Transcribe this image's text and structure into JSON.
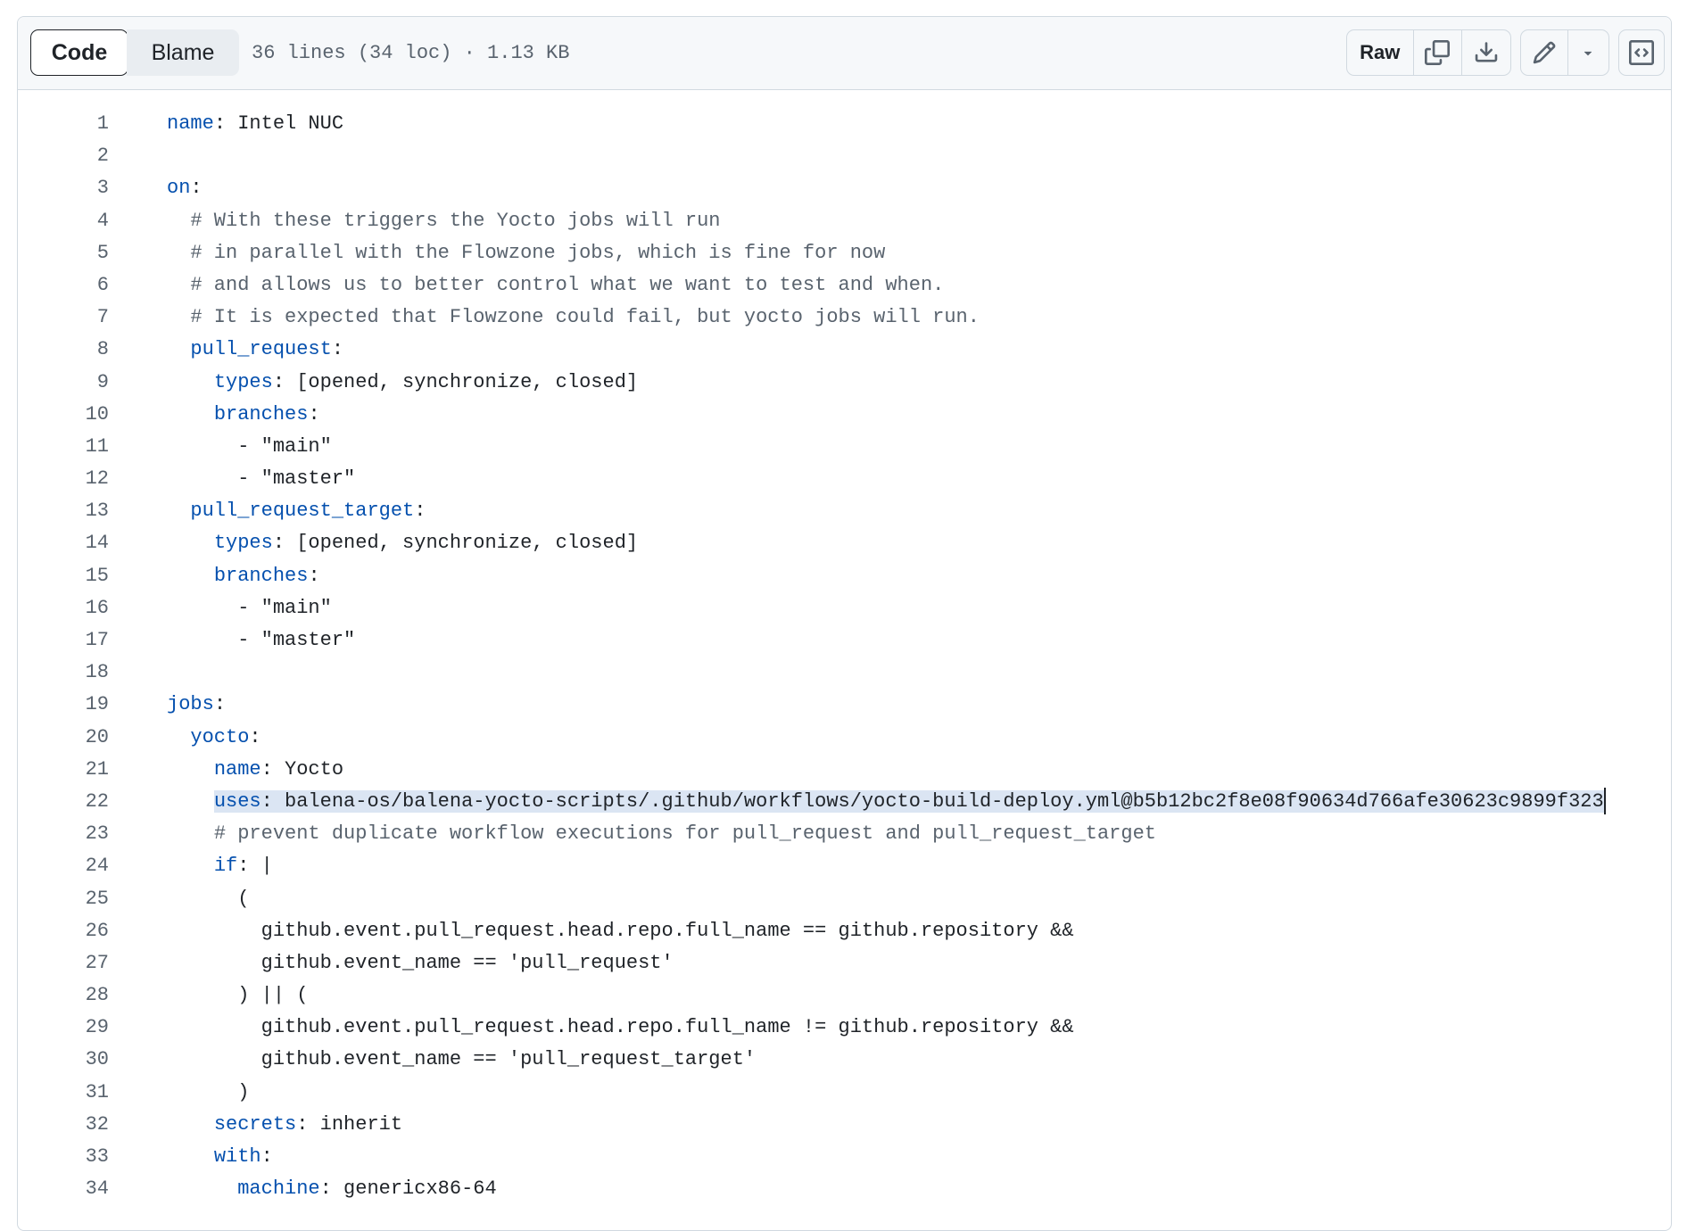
{
  "header": {
    "tab_code": "Code",
    "tab_blame": "Blame",
    "file_info": "36 lines (34 loc) · 1.13 KB",
    "raw_label": "Raw",
    "icons": [
      "copy-icon",
      "download-icon",
      "pencil-icon",
      "chevron-down-icon",
      "code-square-icon"
    ]
  },
  "colors": {
    "key": "#0550ae",
    "value": "#1f2328",
    "string": "#0a3069",
    "comment": "#59636e",
    "selection": "#dbe5f3"
  },
  "code": {
    "lines": [
      {
        "n": "1",
        "indent": "",
        "key": "name",
        "rest": "Intel NUC"
      },
      {
        "n": "2",
        "indent": "",
        "key": "",
        "rest": ""
      },
      {
        "n": "3",
        "indent": "",
        "key": "on",
        "rest": ""
      },
      {
        "n": "4",
        "indent": "  ",
        "comment": "# With these triggers the Yocto jobs will run"
      },
      {
        "n": "5",
        "indent": "  ",
        "comment": "# in parallel with the Flowzone jobs, which is fine for now"
      },
      {
        "n": "6",
        "indent": "  ",
        "comment": "# and allows us to better control what we want to test and when."
      },
      {
        "n": "7",
        "indent": "  ",
        "comment": "# It is expected that Flowzone could fail, but yocto jobs will run."
      },
      {
        "n": "8",
        "indent": "  ",
        "key": "pull_request",
        "rest": ""
      },
      {
        "n": "9",
        "indent": "    ",
        "key": "types",
        "rest": "[opened, synchronize, closed]"
      },
      {
        "n": "10",
        "indent": "    ",
        "key": "branches",
        "rest": ""
      },
      {
        "n": "11",
        "indent": "      ",
        "plain": "- \"main\""
      },
      {
        "n": "12",
        "indent": "      ",
        "plain": "- \"master\""
      },
      {
        "n": "13",
        "indent": "  ",
        "key": "pull_request_target",
        "rest": ""
      },
      {
        "n": "14",
        "indent": "    ",
        "key": "types",
        "rest": "[opened, synchronize, closed]"
      },
      {
        "n": "15",
        "indent": "    ",
        "key": "branches",
        "rest": ""
      },
      {
        "n": "16",
        "indent": "      ",
        "plain": "- \"main\""
      },
      {
        "n": "17",
        "indent": "      ",
        "plain": "- \"master\""
      },
      {
        "n": "18",
        "indent": "",
        "key": "",
        "rest": ""
      },
      {
        "n": "19",
        "indent": "",
        "key": "jobs",
        "rest": ""
      },
      {
        "n": "20",
        "indent": "  ",
        "key": "yocto",
        "rest": ""
      },
      {
        "n": "21",
        "indent": "    ",
        "key": "name",
        "rest": "Yocto"
      },
      {
        "n": "22",
        "indent": "    ",
        "key": "uses",
        "rest": "balena-os/balena-yocto-scripts/.github/workflows/yocto-build-deploy.yml@b5b12bc2f8e08f90634d766afe30623c9899f323",
        "selected": true
      },
      {
        "n": "23",
        "indent": "    ",
        "comment": "# prevent duplicate workflow executions for pull_request and pull_request_target"
      },
      {
        "n": "24",
        "indent": "    ",
        "key": "if",
        "rest": "|"
      },
      {
        "n": "25",
        "indent": "      ",
        "plain": "("
      },
      {
        "n": "26",
        "indent": "        ",
        "plain": "github.event.pull_request.head.repo.full_name == github.repository &&"
      },
      {
        "n": "27",
        "indent": "        ",
        "plain": "github.event_name == 'pull_request'"
      },
      {
        "n": "28",
        "indent": "      ",
        "plain": ") || ("
      },
      {
        "n": "29",
        "indent": "        ",
        "plain": "github.event.pull_request.head.repo.full_name != github.repository &&"
      },
      {
        "n": "30",
        "indent": "        ",
        "plain": "github.event_name == 'pull_request_target'"
      },
      {
        "n": "31",
        "indent": "      ",
        "plain": ")"
      },
      {
        "n": "32",
        "indent": "    ",
        "key": "secrets",
        "rest": "inherit"
      },
      {
        "n": "33",
        "indent": "    ",
        "key": "with",
        "rest": ""
      },
      {
        "n": "34",
        "indent": "      ",
        "key": "machine",
        "rest": "genericx86-64"
      }
    ]
  }
}
